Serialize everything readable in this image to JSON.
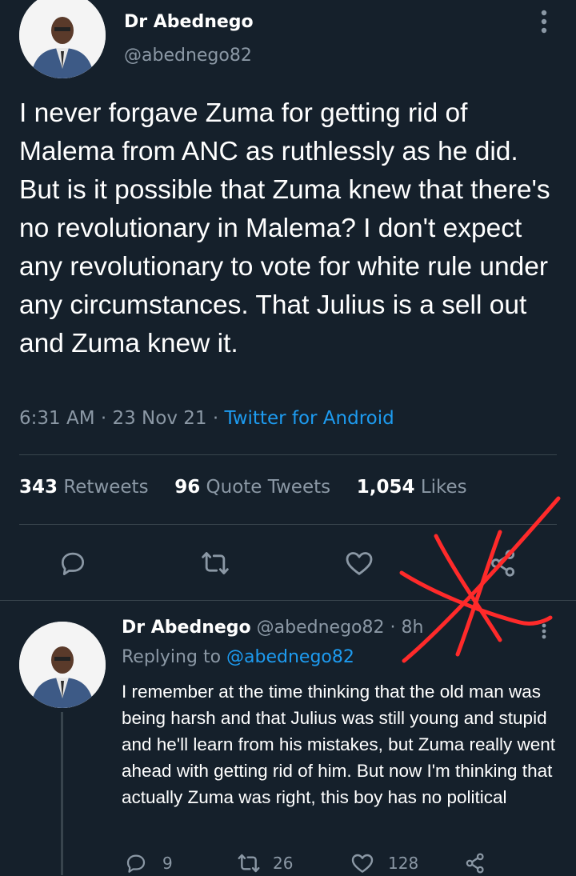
{
  "main_tweet": {
    "author_name": "Dr Abednego",
    "author_handle": "@abednego82",
    "text": "I never forgave Zuma for getting rid of Malema from ANC as ruthlessly as he did. But is it possible that Zuma knew that there's no revolutionary in Malema? I don't expect any revolutionary to vote for white rule under any circumstances. That Julius is a sell out and Zuma knew it.",
    "time": "6:31 AM",
    "date": "23 Nov 21",
    "source": "Twitter for Android",
    "stats": {
      "retweets_count": "343",
      "retweets_label": "Retweets",
      "quotes_count": "96",
      "quotes_label": "Quote Tweets",
      "likes_count": "1,054",
      "likes_label": "Likes"
    }
  },
  "reply_tweet": {
    "author_name": "Dr Abednego",
    "author_handle": "@abednego82",
    "age": "8h",
    "replying_prefix": "Replying to",
    "replying_handle": "@abednego82",
    "text": "I remember at the time thinking that the old man was being harsh and that Julius was still young and stupid and he'll learn from his mistakes, but Zuma really went ahead with getting rid of him. But now I'm thinking that actually Zuma was right, this boy has no political",
    "replies": "9",
    "retweets": "26",
    "likes": "128"
  },
  "colors": {
    "background": "#15202b",
    "muted": "#8b98a5",
    "link": "#1d9bf0",
    "annotation": "#ff2a2a"
  }
}
